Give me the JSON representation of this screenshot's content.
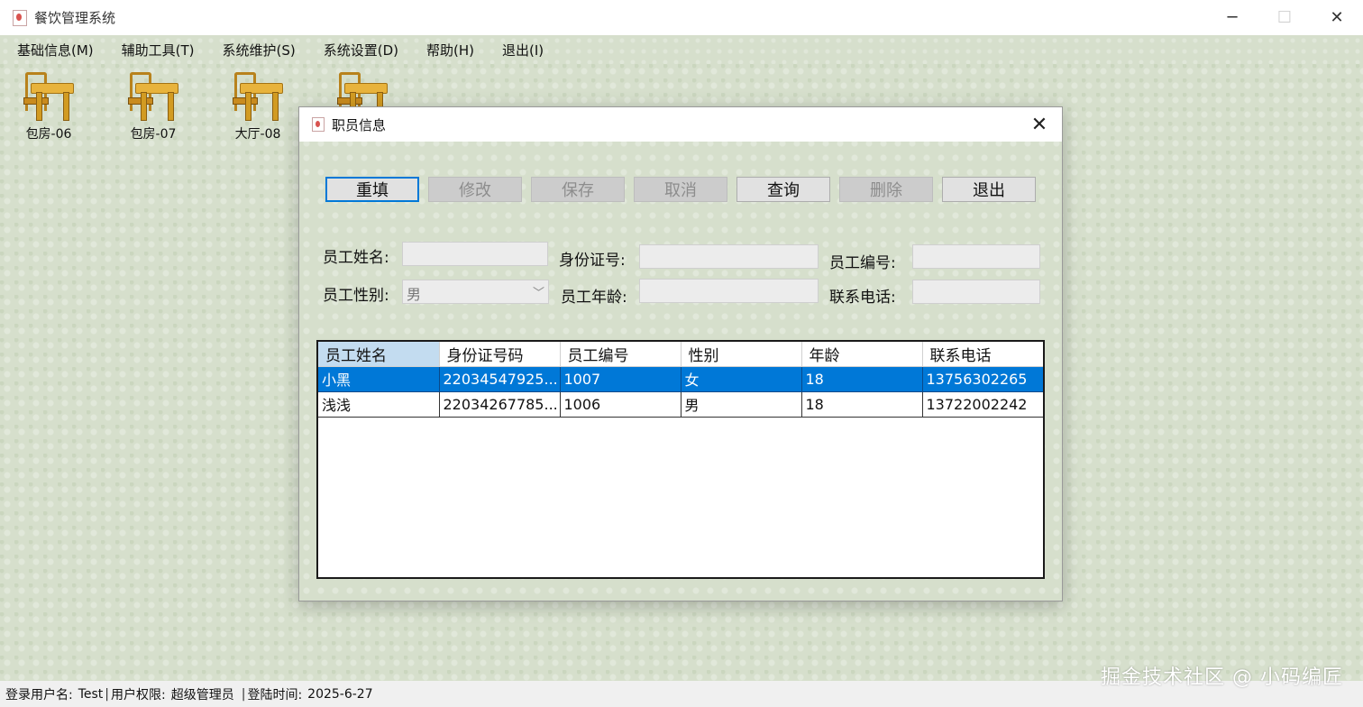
{
  "window": {
    "title": "餐饮管理系统",
    "min": "─",
    "max": "☐",
    "close": "✕"
  },
  "menu": [
    {
      "label": "基础信息(M)"
    },
    {
      "label": "辅助工具(T)"
    },
    {
      "label": "系统维护(S)"
    },
    {
      "label": "系统设置(D)"
    },
    {
      "label": "帮助(H)"
    },
    {
      "label": "退出(I)"
    }
  ],
  "rooms": [
    {
      "label": "包房-06"
    },
    {
      "label": "包房-07"
    },
    {
      "label": "大厅-08"
    },
    {
      "label": ""
    }
  ],
  "dialog": {
    "title": "职员信息",
    "close": "✕",
    "buttons": {
      "reset": "重填",
      "edit": "修改",
      "save": "保存",
      "cancel": "取消",
      "query": "查询",
      "delete": "删除",
      "exit": "退出"
    },
    "form": {
      "name_label": "员工姓名:",
      "name_value": "",
      "id_label": "身份证号:",
      "id_value": "",
      "no_label": "员工编号:",
      "no_value": "",
      "gender_label": "员工性别:",
      "gender_value": "男",
      "age_label": "员工年龄:",
      "age_value": "",
      "phone_label": "联系电话:",
      "phone_value": ""
    },
    "table": {
      "headers": [
        "员工姓名",
        "身份证号码",
        "员工编号",
        "性别",
        "年龄",
        "联系电话"
      ],
      "rows": [
        [
          "小黑",
          "22034547925...",
          "1007",
          "女",
          "18",
          "13756302265"
        ],
        [
          "浅浅",
          "22034267785...",
          "1006",
          "男",
          "18",
          "13722002242"
        ]
      ]
    }
  },
  "status": {
    "user_label": "登录用户名:",
    "user_value": "Test",
    "role_label": "用户权限:",
    "role_value": "超级管理员",
    "time_label": "登陆时间:",
    "time_value": "2025-6-27",
    "sep": "|"
  },
  "watermark": "掘金技术社区 @ 小码编匠"
}
